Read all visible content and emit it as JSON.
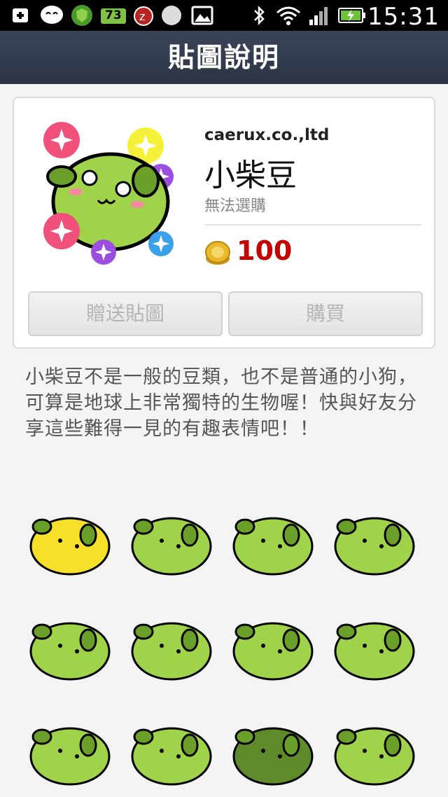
{
  "status_bar": {
    "time": "15:31",
    "notification_badge": "73",
    "icons": [
      "add-icon",
      "chat-icon",
      "shield-icon",
      "badge-icon",
      "alarm-icon",
      "circle-icon",
      "image-icon",
      "bluetooth-icon",
      "wifi-icon",
      "signal-icon",
      "battery-icon"
    ]
  },
  "header": {
    "title": "貼圖說明"
  },
  "product": {
    "author": "caerux.co.,ltd",
    "name": "小柴豆",
    "status": "無法選購",
    "price": "100",
    "gift_button": "贈送貼圖",
    "buy_button": "購買"
  },
  "description": "小柴豆不是一般的豆類，也不是普通的小狗，可算是地球上非常獨特的生物喔！快與好友分享這些難得一見的有趣表情吧！！",
  "stickers": [
    {
      "name": "yellow-bean-sticker",
      "body": "#f7e02a"
    },
    {
      "name": "angry-bean-sticker",
      "body": "#9fd34a"
    },
    {
      "name": "sweating-bean-sticker",
      "body": "#9fd34a"
    },
    {
      "name": "love-bean-sticker",
      "body": "#9fd34a"
    },
    {
      "name": "blushing-bean-sticker",
      "body": "#9fd34a"
    },
    {
      "name": "question-bean-sticker",
      "body": "#9fd34a"
    },
    {
      "name": "hat-bean-sticker",
      "body": "#9fd34a"
    },
    {
      "name": "sparkle-bean-sticker",
      "body": "#9fd34a"
    },
    {
      "name": "scarf-bean-sticker",
      "body": "#9fd34a"
    },
    {
      "name": "helmet-bean-sticker",
      "body": "#9fd34a"
    },
    {
      "name": "shocked-bean-sticker",
      "body": "#5f8a2a"
    },
    {
      "name": "sleeping-bean-sticker",
      "body": "#9fd34a"
    }
  ],
  "colors": {
    "price": "#c50000",
    "header_bg": "#2f3849",
    "bean": "#9fd34a"
  }
}
